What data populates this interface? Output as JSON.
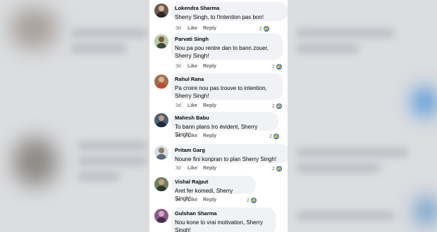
{
  "comments": [
    {
      "author": "Lokendra Sharma",
      "text": "Sherry Singh, to l'intention pas bon!",
      "age": "3d",
      "like": "Like",
      "reply": "Reply",
      "reactions": "2",
      "reaction_icon": "like-icon"
    },
    {
      "author": "Parvati Singh",
      "text": "Nou pa pou rentre dan to bann zouer, Sherry Singh!",
      "age": "3d",
      "like": "Like",
      "reply": "Reply",
      "reactions": "2",
      "reaction_icon": "like-icon"
    },
    {
      "author": "Rahul Rana",
      "text": "Pa croire nou pas trouve to intention, Sherry Singh!",
      "age": "3d",
      "like": "Like",
      "reply": "Reply",
      "reactions": "2",
      "reaction_icon": "like-icon"
    },
    {
      "author": "Mahesh Babu",
      "text": "To bann plans tro évident, Sherry Singh!",
      "age": "3d",
      "like": "Like",
      "reply": "Reply",
      "reactions": "2",
      "reaction_icon": "like-icon"
    },
    {
      "author": "Pritam Garg",
      "text": "Noune fini konpran to plan Sherry Singh!",
      "age": "3d",
      "like": "Like",
      "reply": "Reply",
      "reactions": "2",
      "reaction_icon": "like-icon"
    },
    {
      "author": "Vishal Rajput",
      "text": "Aret fer komedi, Sherry Singh!",
      "age": "3d",
      "like": "Like",
      "reply": "Reply",
      "reactions": "2",
      "reaction_icon": "like-icon"
    },
    {
      "author": "Gulshan Sharma",
      "text": "Nou kone to vrai motivation, Sherry Singh!",
      "age": "",
      "like": "",
      "reply": "",
      "reactions": "",
      "reaction_icon": ""
    }
  ],
  "colors": {
    "bubble": "#f0f2f5",
    "meta": "#65676b",
    "reaction": "#1877f2"
  }
}
